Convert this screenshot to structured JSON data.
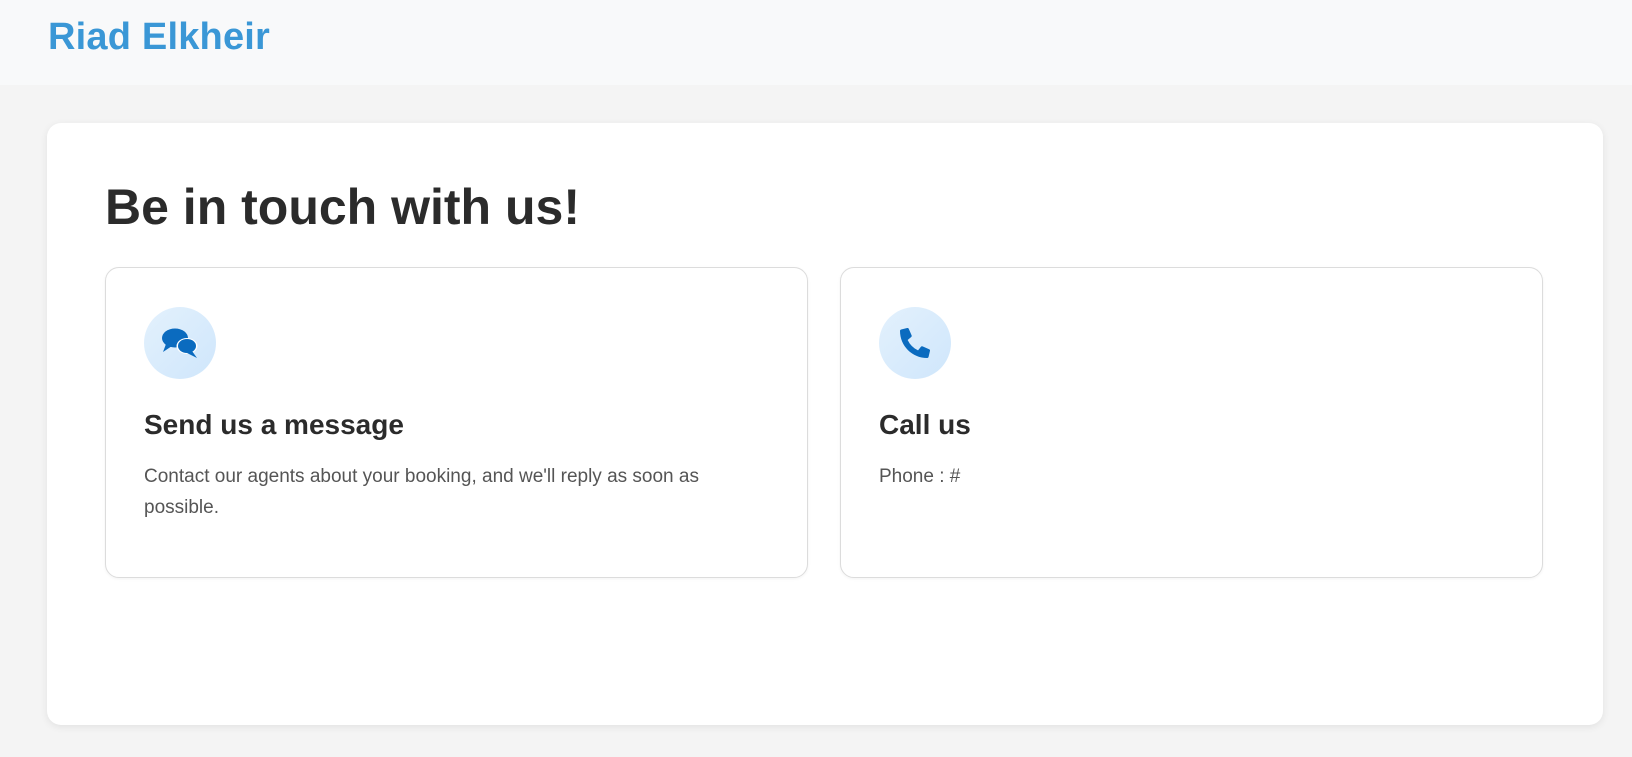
{
  "header": {
    "brand": "Riad Elkheir"
  },
  "main": {
    "title": "Be in touch with us!",
    "cards": [
      {
        "icon": "chat-bubbles-icon",
        "title": "Send us a message",
        "text": "Contact our agents about your booking, and we'll reply as soon as possible."
      },
      {
        "icon": "phone-icon",
        "title": "Call us",
        "text": "Phone : #"
      }
    ]
  },
  "colors": {
    "brand": "#3a97d6",
    "icon": "#0b6bbf",
    "icon_bg": "#d9ecfc",
    "page_bg": "#f4f4f4"
  }
}
